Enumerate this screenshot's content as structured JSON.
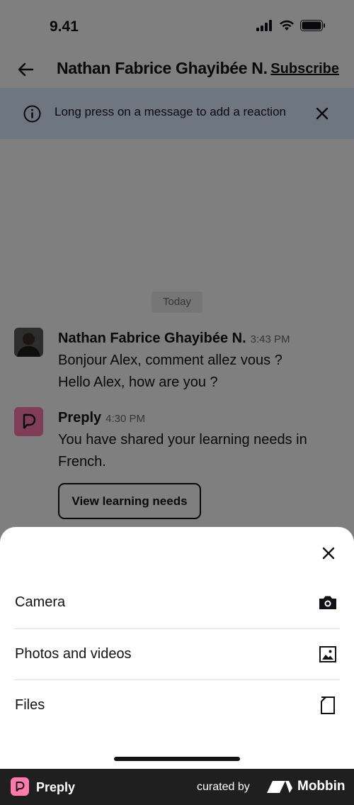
{
  "status_bar": {
    "time": "9.41"
  },
  "header": {
    "title": "Nathan Fabrice Ghayibée N.",
    "subscribe_label": "Subscribe"
  },
  "banner": {
    "text": "Long press on a message to add a reaction"
  },
  "chat": {
    "date_label": "Today",
    "messages": [
      {
        "sender": "Nathan Fabrice Ghayibée N.",
        "time": "3:43 PM",
        "lines": [
          "Bonjour Alex, comment allez vous ?",
          "Hello Alex, how are you ?"
        ]
      },
      {
        "sender": "Preply",
        "time": "4:30 PM",
        "text": "You have shared your learning needs in French.",
        "button_label": "View learning needs"
      }
    ]
  },
  "sheet": {
    "options": [
      {
        "label": "Camera",
        "icon": "camera-icon"
      },
      {
        "label": "Photos and videos",
        "icon": "image-icon"
      },
      {
        "label": "Files",
        "icon": "file-icon"
      }
    ]
  },
  "footer": {
    "brand": "Preply",
    "curated_by": "curated by",
    "mobbin": "Mobbin"
  },
  "colors": {
    "banner_bg": "#dceeff",
    "preply_pink": "#ff7aac",
    "text": "#121117",
    "footer_bg": "#1f1f1f"
  }
}
